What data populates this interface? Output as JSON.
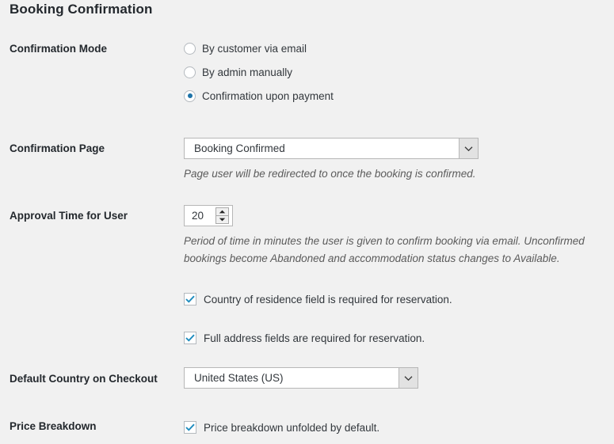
{
  "page": {
    "title": "Booking Confirmation"
  },
  "confirmation_mode": {
    "label": "Confirmation Mode",
    "options": [
      {
        "label": "By customer via email",
        "selected": false
      },
      {
        "label": "By admin manually",
        "selected": false
      },
      {
        "label": "Confirmation upon payment",
        "selected": true
      }
    ]
  },
  "confirmation_page": {
    "label": "Confirmation Page",
    "value": "Booking Confirmed",
    "description": "Page user will be redirected to once the booking is confirmed."
  },
  "approval_time": {
    "label": "Approval Time for User",
    "value": "20",
    "description_line1": "Period of time in minutes the user is given to confirm booking via email. Unconfirmed",
    "description_line2": "bookings become Abandoned and accommodation status changes to Available."
  },
  "country_required": {
    "label": "Country of residence field is required for reservation.",
    "checked": true
  },
  "address_required": {
    "label": "Full address fields are required for reservation.",
    "checked": true
  },
  "default_country": {
    "label": "Default Country on Checkout",
    "value": "United States (US)"
  },
  "price_breakdown": {
    "label": "Price Breakdown",
    "checkbox_label": "Price breakdown unfolded by default.",
    "checked": true
  },
  "colors": {
    "background": "#f1f1f1",
    "accent": "#1e73a8",
    "label_text": "#23282d",
    "description_text": "#5b5b5b"
  },
  "icons": {
    "select_arrow": "chevron-down-icon",
    "spinner_up": "caret-up-icon",
    "spinner_down": "caret-down-icon",
    "checkmark": "check-icon"
  }
}
